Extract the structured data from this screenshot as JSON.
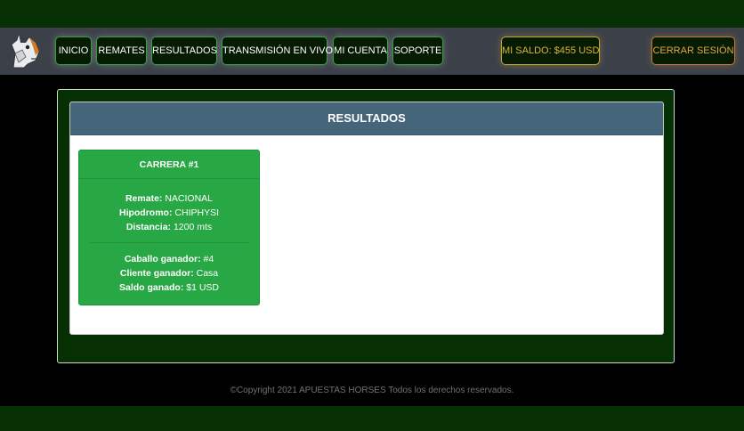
{
  "nav": {
    "items": [
      {
        "label": "INICIO"
      },
      {
        "label": "REMATES"
      },
      {
        "label": "RESULTADOS"
      },
      {
        "label": "TRANSMISIÓN EN VIVO"
      },
      {
        "label": "MI CUENTA"
      },
      {
        "label": "SOPORTE"
      }
    ],
    "saldo": "MI SALDO: $455 USD",
    "logout": "CERRAR SESIÓN"
  },
  "main": {
    "title": "RESULTADOS",
    "race": {
      "title": "CARRERA #1",
      "remate_label": "Remate:",
      "remate_value": "NACIONAL",
      "hipodromo_label": "Hipodromo:",
      "hipodromo_value": "CHIPHYSI",
      "distancia_label": "Distancia:",
      "distancia_value": "1200 mts",
      "caballo_label": "Caballo ganador:",
      "caballo_value": "#4",
      "cliente_label": "Cliente ganador:",
      "cliente_value": "Casa",
      "saldo_label": "Saldo ganado:",
      "saldo_value": "$1 USD"
    }
  },
  "footer": {
    "text": "©Copyright 2021 APUESTAS HORSES Todos los derechos reservados."
  },
  "colors": {
    "band_green": "#073004",
    "navbar": "#3c4149",
    "header_blue": "#45657b",
    "race_green": "#28a745",
    "saldo_gold": "#e0b23a",
    "logout_orange": "#e0a64a"
  },
  "icons": {
    "logo": "horse-head-logo"
  }
}
